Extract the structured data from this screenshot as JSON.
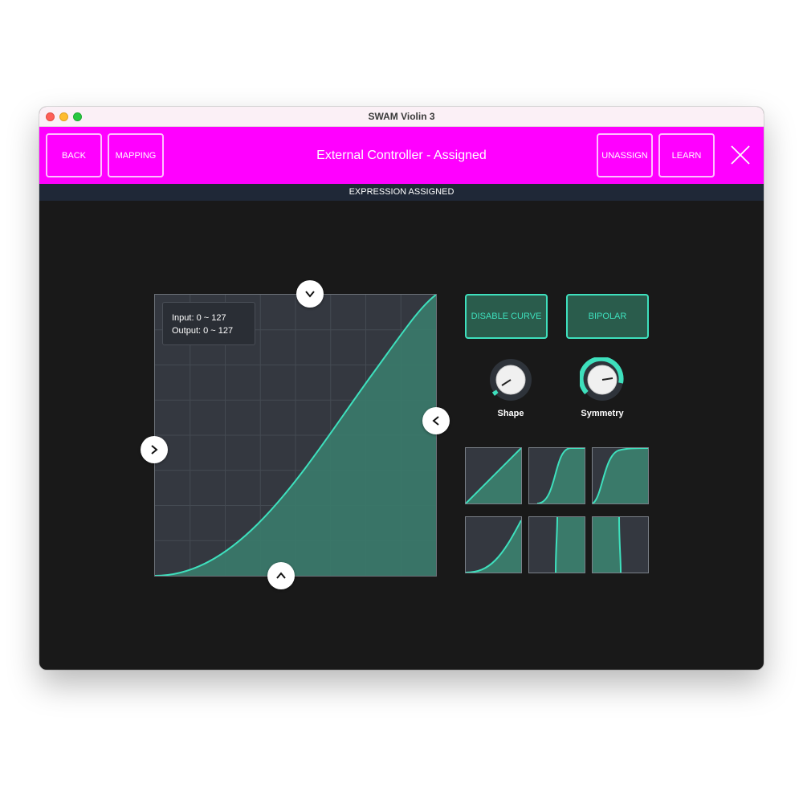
{
  "window": {
    "title": "SWAM Violin 3"
  },
  "header": {
    "back_label": "BACK",
    "mapping_label": "MAPPING",
    "title": "External Controller - Assigned",
    "unassign_label": "UNASSIGN",
    "learn_label": "LEARN",
    "close_icon": "close-icon"
  },
  "status": {
    "text": "EXPRESSION ASSIGNED"
  },
  "graph": {
    "input_range": "Input: 0 ~ 127",
    "output_range": "Output: 0 ~ 127"
  },
  "controls": {
    "disable_curve_label": "DISABLE CURVE",
    "bipolar_label": "BIPOLAR",
    "shape_label": "Shape",
    "symmetry_label": "Symmetry"
  },
  "colors": {
    "header": "#ff00ff",
    "accent": "#3ee0bd",
    "fill": "#3a7a6a",
    "panel": "#343840",
    "background": "#191919",
    "status_bar": "#1f2837"
  },
  "icons": {
    "top_handle": "chevron-down-icon",
    "bottom_handle": "chevron-up-icon",
    "left_handle": "chevron-right-icon",
    "right_handle": "chevron-left-icon"
  }
}
